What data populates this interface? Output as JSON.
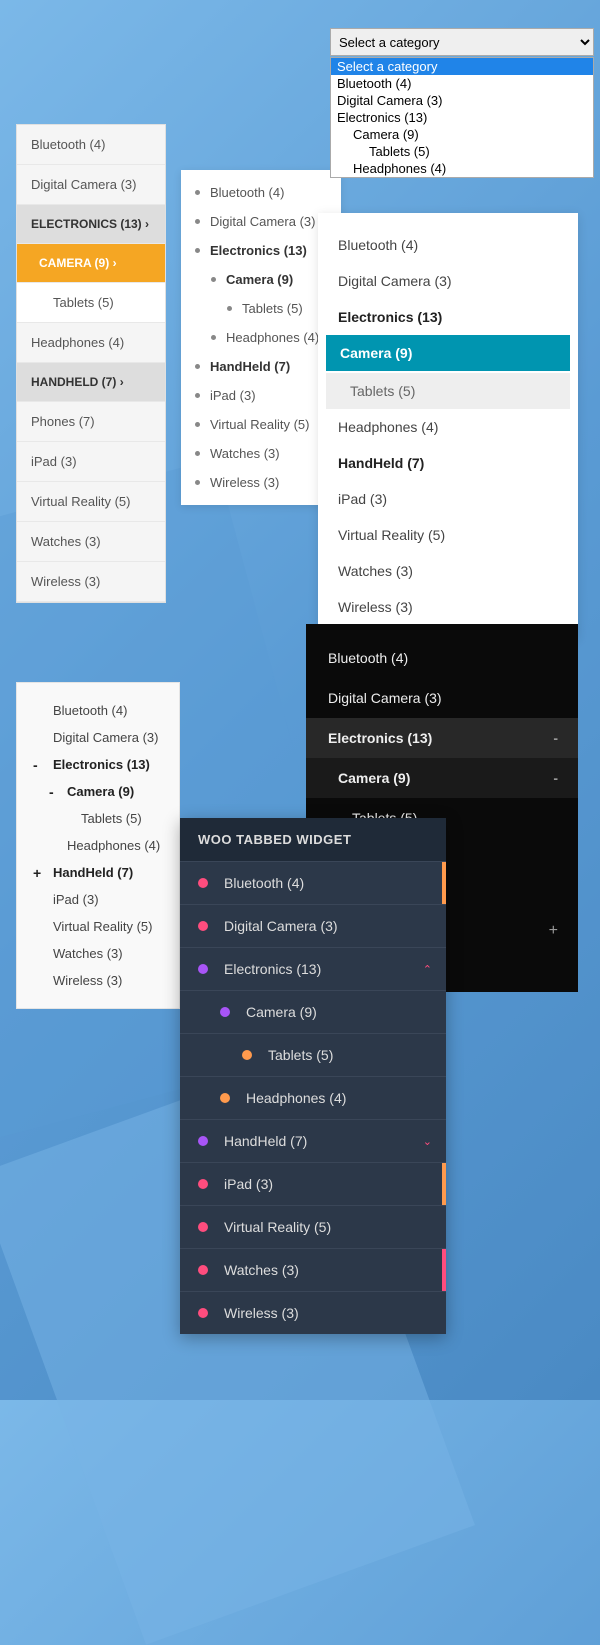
{
  "categories": {
    "bluetooth": "Bluetooth (4)",
    "digital_camera": "Digital Camera (3)",
    "electronics": "Electronics (13)",
    "electronics_upper": "ELECTRONICS (13)",
    "camera": "Camera (9)",
    "camera_upper": "CAMERA (9)",
    "tablets": "Tablets (5)",
    "headphones": "Headphones (4)",
    "handheld": "HandHeld (7)",
    "handheld_upper": "HANDHELD (7)",
    "phones": "Phones (7)",
    "ipad": "iPad (3)",
    "virtual_reality": "Virtual Reality (5)",
    "watches": "Watches (3)",
    "wireless": "Wireless (3)"
  },
  "select": {
    "placeholder": "Select a category",
    "options": {
      "opt0": "Select a category",
      "opt1": "Bluetooth  (4)",
      "opt2": "Digital Camera  (3)",
      "opt3": "Electronics  (13)",
      "opt4": "   Camera  (9)",
      "opt5": "      Tablets  (5)",
      "opt6": "   Headphones  (4)"
    }
  },
  "woo": {
    "title": "WOO TABBED WIDGET"
  },
  "symbols": {
    "chevron_right": "›",
    "chevron_up": "⌃",
    "chevron_down": "⌄",
    "plus": "+",
    "minus": "-"
  }
}
